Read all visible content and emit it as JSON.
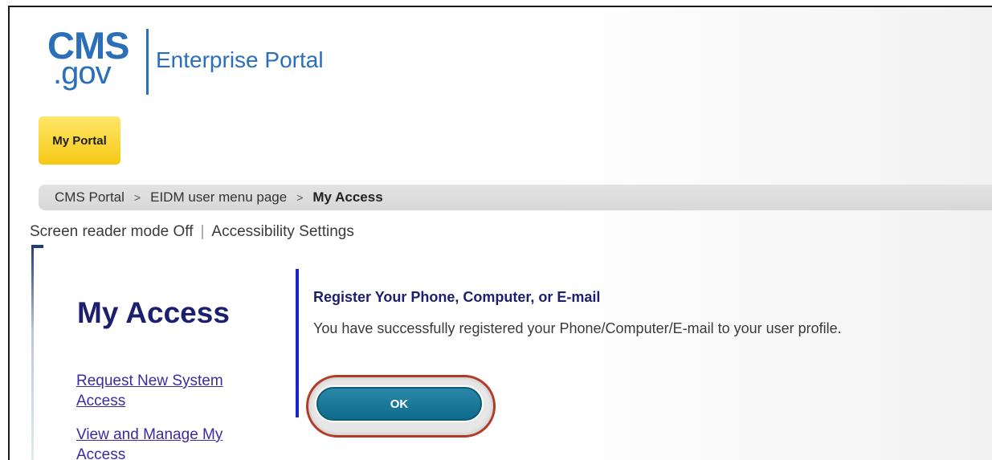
{
  "logo": {
    "primary": "CMS",
    "secondary": ".gov",
    "subtitle": "Enterprise Portal"
  },
  "nav": {
    "tabs": [
      {
        "label": "My Portal",
        "active": true
      }
    ]
  },
  "breadcrumb": {
    "items": [
      "CMS Portal",
      "EIDM user menu page",
      "My Access"
    ],
    "separator": ">"
  },
  "accessibility": {
    "screen_reader": "Screen reader mode Off",
    "divider": "|",
    "settings": "Accessibility Settings"
  },
  "sidebar": {
    "title": "My Access",
    "links": [
      "Request New System Access",
      "View and Manage My Access"
    ]
  },
  "content": {
    "heading": "Register Your Phone, Computer, or E-mail",
    "message": "You have successfully registered your Phone/Computer/E-mail to your user profile.",
    "ok_label": "OK"
  },
  "colors": {
    "brand_blue": "#2a6fb7",
    "tab_yellow": "#f6c814",
    "ok_button": "#0f6b8c",
    "highlight_red": "#b33a26",
    "divider_blue": "#1a26c9"
  }
}
